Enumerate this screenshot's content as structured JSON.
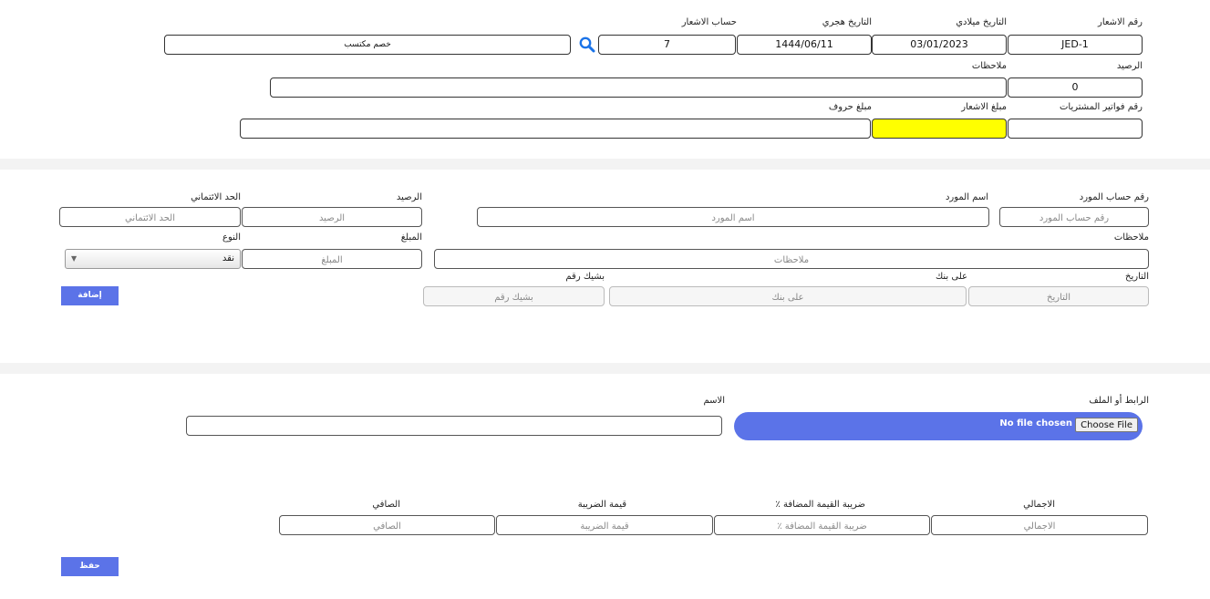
{
  "notice": {
    "labels": {
      "notice_no": "رقم الاشعار",
      "gregorian_date": "التاريخ ميلادي",
      "hijri_date": "التاريخ هجري",
      "notice_account": "حساب الاشعار",
      "balance": "الرصيد",
      "notes": "ملاحظات",
      "purchase_invoice_no": "رقم فواتير المشتريات",
      "notice_amount": "مبلغ الاشعار",
      "amount_words": "مبلغ حروف"
    },
    "values": {
      "notice_no": "JED-1",
      "gregorian_date": "03/01/2023",
      "hijri_date": "1444/06/11",
      "notice_account": "7",
      "account_name": "خصم مكتسب",
      "balance": "0",
      "notes": "",
      "purchase_invoice_no": "",
      "notice_amount": "",
      "amount_words": ""
    },
    "highlight_color": "#ffff00",
    "search_icon": "search-icon"
  },
  "supplier": {
    "labels": {
      "account_no": "رقم حساب المورد",
      "name": "اسم المورد",
      "balance": "الرصيد",
      "credit_limit": "الحد الائتماني",
      "notes": "ملاحظات",
      "amount": "المبلغ",
      "type": "النوع",
      "date": "التاريخ",
      "bank": "على بنك",
      "cheque_no": "بشيك رقم"
    },
    "placeholders": {
      "account_no": "رقم حساب المورد",
      "name": "اسم المورد",
      "balance": "الرصيد",
      "credit_limit": "الحد الائتماني",
      "notes": "ملاحظات",
      "amount": "المبلغ",
      "date": "التاريخ",
      "bank": "على بنك",
      "cheque_no": "بشيك رقم"
    },
    "type_value": "نقد",
    "add_label": "إضافة"
  },
  "attachment": {
    "labels": {
      "link_or_file": "الرابط أو الملف",
      "name": "الاسم"
    },
    "choose_file": "Choose File",
    "no_file": "No file chosen"
  },
  "totals": {
    "labels": {
      "total": "الاجمالي",
      "vat_percent": "ضريبة القيمة المضافة ٪",
      "tax_value": "قيمة الضريبة",
      "net": "الصافي"
    },
    "placeholders": {
      "total": "الاجمالي",
      "vat_percent": "ضريبة القيمة المضافة ٪",
      "tax_value": "قيمة الضريبة",
      "net": "الصافي"
    },
    "save_label": "حفظ"
  },
  "colors": {
    "primary": "#5b73e8",
    "search_icon": "#1a73e8"
  }
}
